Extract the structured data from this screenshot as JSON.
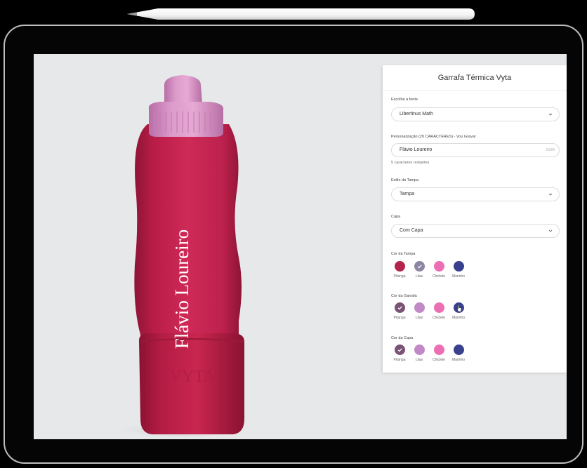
{
  "product_title": "Garrafa Térmica Vyta",
  "bottle_text": "Flávio Loureiro",
  "bottle_brand": "VYTA",
  "font": {
    "label": "Escolha a fonte",
    "value": "Libertinus Math"
  },
  "personalization": {
    "label": "Personalização (20 CARACTERES) - Vou Gravar",
    "value": "Flávio Loureiro",
    "counter": "15/20",
    "helper": "5 caracteres restantes"
  },
  "lid_style": {
    "label": "Estilo da Tampa",
    "value": "Tampa"
  },
  "sleeve": {
    "label": "Capa",
    "value": "Com Capa"
  },
  "lid_color": {
    "label": "Cor da Tampa",
    "options": [
      {
        "name": "Pitanga",
        "color": "#b3244a"
      },
      {
        "name": "Lilas",
        "color": "#8d86a3"
      },
      {
        "name": "Chiclete",
        "color": "#ec6fb4"
      },
      {
        "name": "Marinho",
        "color": "#39418f"
      }
    ]
  },
  "bottle_color": {
    "label": "Cor da Garrafa",
    "options": [
      {
        "name": "Pitanga",
        "color": "#7a5275"
      },
      {
        "name": "Lilas",
        "color": "#c18ac7"
      },
      {
        "name": "Chiclete",
        "color": "#ec6fb4"
      },
      {
        "name": "Marinho",
        "color": "#39418f"
      }
    ]
  },
  "sleeve_color": {
    "label": "Cor da Capa",
    "options": [
      {
        "name": "Pitanga",
        "color": "#7a5275"
      },
      {
        "name": "Lilas",
        "color": "#c18ac7"
      },
      {
        "name": "Chiclete",
        "color": "#ec6fb4"
      },
      {
        "name": "Marinho",
        "color": "#39418f"
      }
    ]
  },
  "colors": {
    "bottle_body": "#c7244f",
    "bottle_lid": "#d58fc4",
    "engraving": "#ffffff"
  }
}
